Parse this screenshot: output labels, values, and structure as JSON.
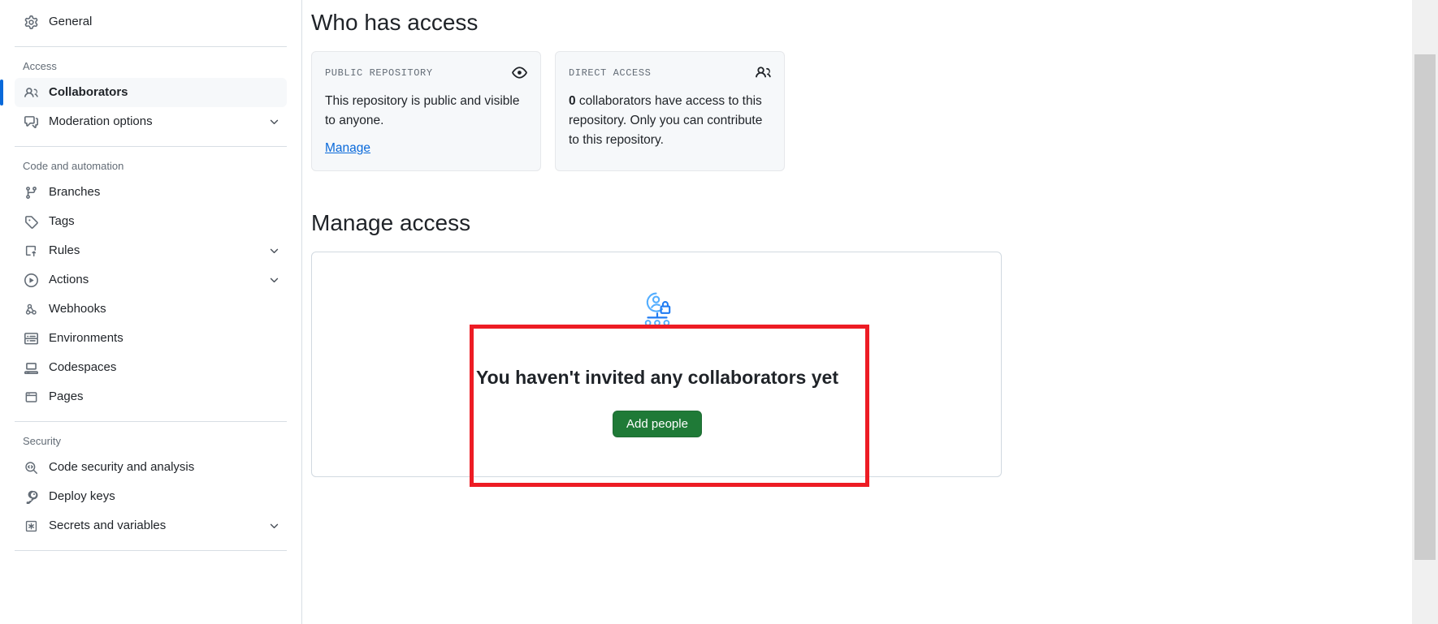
{
  "sidebar": {
    "groups": [
      {
        "title": null,
        "items": [
          {
            "label": "General",
            "icon": "gear-icon",
            "selected": false,
            "chevron": false
          }
        ]
      },
      {
        "title": "Access",
        "items": [
          {
            "label": "Collaborators",
            "icon": "people-icon",
            "selected": true,
            "chevron": false
          },
          {
            "label": "Moderation options",
            "icon": "comment-discussion-icon",
            "selected": false,
            "chevron": true
          }
        ]
      },
      {
        "title": "Code and automation",
        "items": [
          {
            "label": "Branches",
            "icon": "git-branch-icon",
            "selected": false,
            "chevron": false
          },
          {
            "label": "Tags",
            "icon": "tag-icon",
            "selected": false,
            "chevron": false
          },
          {
            "label": "Rules",
            "icon": "rules-icon",
            "selected": false,
            "chevron": true
          },
          {
            "label": "Actions",
            "icon": "play-circle-icon",
            "selected": false,
            "chevron": true
          },
          {
            "label": "Webhooks",
            "icon": "webhook-icon",
            "selected": false,
            "chevron": false
          },
          {
            "label": "Environments",
            "icon": "server-icon",
            "selected": false,
            "chevron": false
          },
          {
            "label": "Codespaces",
            "icon": "codespaces-icon",
            "selected": false,
            "chevron": false
          },
          {
            "label": "Pages",
            "icon": "browser-icon",
            "selected": false,
            "chevron": false
          }
        ]
      },
      {
        "title": "Security",
        "items": [
          {
            "label": "Code security and analysis",
            "icon": "code-scan-icon",
            "selected": false,
            "chevron": false
          },
          {
            "label": "Deploy keys",
            "icon": "key-icon",
            "selected": false,
            "chevron": false
          },
          {
            "label": "Secrets and variables",
            "icon": "asterisk-box-icon",
            "selected": false,
            "chevron": true
          }
        ]
      }
    ]
  },
  "main": {
    "who_has_access": {
      "title": "Who has access",
      "cards": [
        {
          "eyebrow": "PUBLIC REPOSITORY",
          "icon": "eye-icon",
          "body_lead": "",
          "body": "This repository is public and visible to anyone.",
          "link": "Manage"
        },
        {
          "eyebrow": "DIRECT ACCESS",
          "icon": "people-icon",
          "body_lead": "0",
          "body": " collaborators have access to this repository. Only you can contribute to this repository.",
          "link": null
        }
      ]
    },
    "manage_access": {
      "title": "Manage access",
      "blank_state": {
        "illustration": "person-lock-network-icon",
        "heading": "You haven't invited any collaborators yet",
        "button_label": "Add people"
      }
    }
  },
  "annotation": {
    "highlight_color": "#ed1c24"
  },
  "colors": {
    "accent": "#0969da",
    "success_button": "#1f7a37",
    "card_bg": "#f6f8fa",
    "border": "#d1d9e0",
    "muted_text": "#636c76",
    "illustration_blue": "#54aeff"
  }
}
